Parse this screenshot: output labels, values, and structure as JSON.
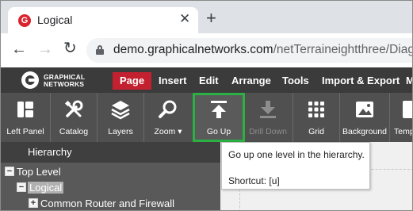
{
  "browser": {
    "tab_title": "Logical",
    "favicon_letter": "G",
    "close_glyph": "✕",
    "newtab_glyph": "+",
    "url_host": "demo.graphicalnetworks.com",
    "url_rest": "/netTerraineightthree/Diagram/",
    "back_glyph": "←",
    "forward_glyph": "→",
    "reload_glyph": "↻"
  },
  "app": {
    "logo_line1": "GRAPHICAL",
    "logo_line2": "NETWORKS",
    "menu": [
      {
        "label": "Page",
        "active": true
      },
      {
        "label": "Insert"
      },
      {
        "label": "Edit"
      },
      {
        "label": "Arrange"
      },
      {
        "label": "Tools"
      },
      {
        "label": "Import & Export"
      },
      {
        "label": "M"
      }
    ],
    "accent_color": "#c42130"
  },
  "toolbar": {
    "buttons": [
      {
        "label": "Left Panel",
        "icon": "left-panel-icon"
      },
      {
        "label": "Catalog",
        "icon": "tools-icon"
      },
      {
        "label": "Layers",
        "icon": "layers-icon"
      },
      {
        "label": "Zoom",
        "icon": "magnifier-icon",
        "dropdown": true,
        "caret": "▾"
      },
      {
        "label": "Go Up",
        "icon": "arrow-up-to-line-icon",
        "highlighted": true
      },
      {
        "label": "Drill Down",
        "icon": "arrow-down-to-line-icon",
        "disabled": true
      },
      {
        "label": "Grid",
        "icon": "grid-icon"
      },
      {
        "label": "Background",
        "icon": "image-icon"
      },
      {
        "label": "Temp",
        "icon": "template-icon"
      }
    ],
    "highlight_color": "#2bb043"
  },
  "hierarchy": {
    "title": "Hierarchy",
    "nodes": [
      {
        "label": "Top Level",
        "toggle": "−",
        "level": 0
      },
      {
        "label": "Logical",
        "toggle": "−",
        "level": 1,
        "selected": true
      },
      {
        "label": "Common Router and Firewall",
        "toggle": "+",
        "level": 2
      }
    ]
  },
  "tooltip": {
    "text": "Go up one level in the hierarchy.",
    "shortcut": "Shortcut: [u]"
  }
}
